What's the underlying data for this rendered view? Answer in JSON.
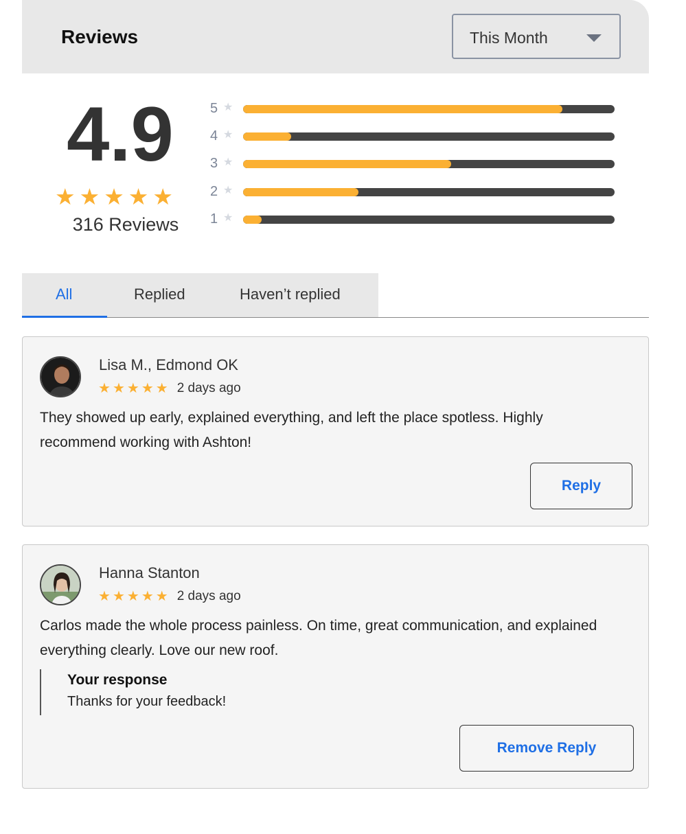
{
  "header": {
    "title": "Reviews",
    "period_selected": "This Month"
  },
  "summary": {
    "score": "4.9",
    "star_rating": 5,
    "review_count": "316 Reviews",
    "distribution": [
      {
        "label": "5",
        "fraction": 0.86
      },
      {
        "label": "4",
        "fraction": 0.13
      },
      {
        "label": "3",
        "fraction": 0.56
      },
      {
        "label": "2",
        "fraction": 0.31
      },
      {
        "label": "1",
        "fraction": 0.05
      }
    ]
  },
  "tabs": [
    {
      "label": "All",
      "active": true
    },
    {
      "label": "Replied",
      "active": false
    },
    {
      "label": "Haven’t replied",
      "active": false
    }
  ],
  "reviews": [
    {
      "name": "Lisa M., Edmond OK",
      "stars": 5,
      "time_ago": "2 days ago",
      "text": "They showed up early, explained everything, and left the place spotless. Highly recommend working with Ashton!",
      "button_label": "Reply"
    },
    {
      "name": "Hanna Stanton",
      "stars": 5,
      "time_ago": "2 days ago",
      "text": "Carlos made the whole process painless. On time, great communication, and explained everything clearly. Love our new roof.",
      "response_title": "Your response",
      "response_text": "Thanks for your feedback!",
      "button_label": "Remove Reply"
    }
  ],
  "colors": {
    "accent": "#1f6fe5",
    "star": "#fbb033",
    "track": "#444444"
  }
}
